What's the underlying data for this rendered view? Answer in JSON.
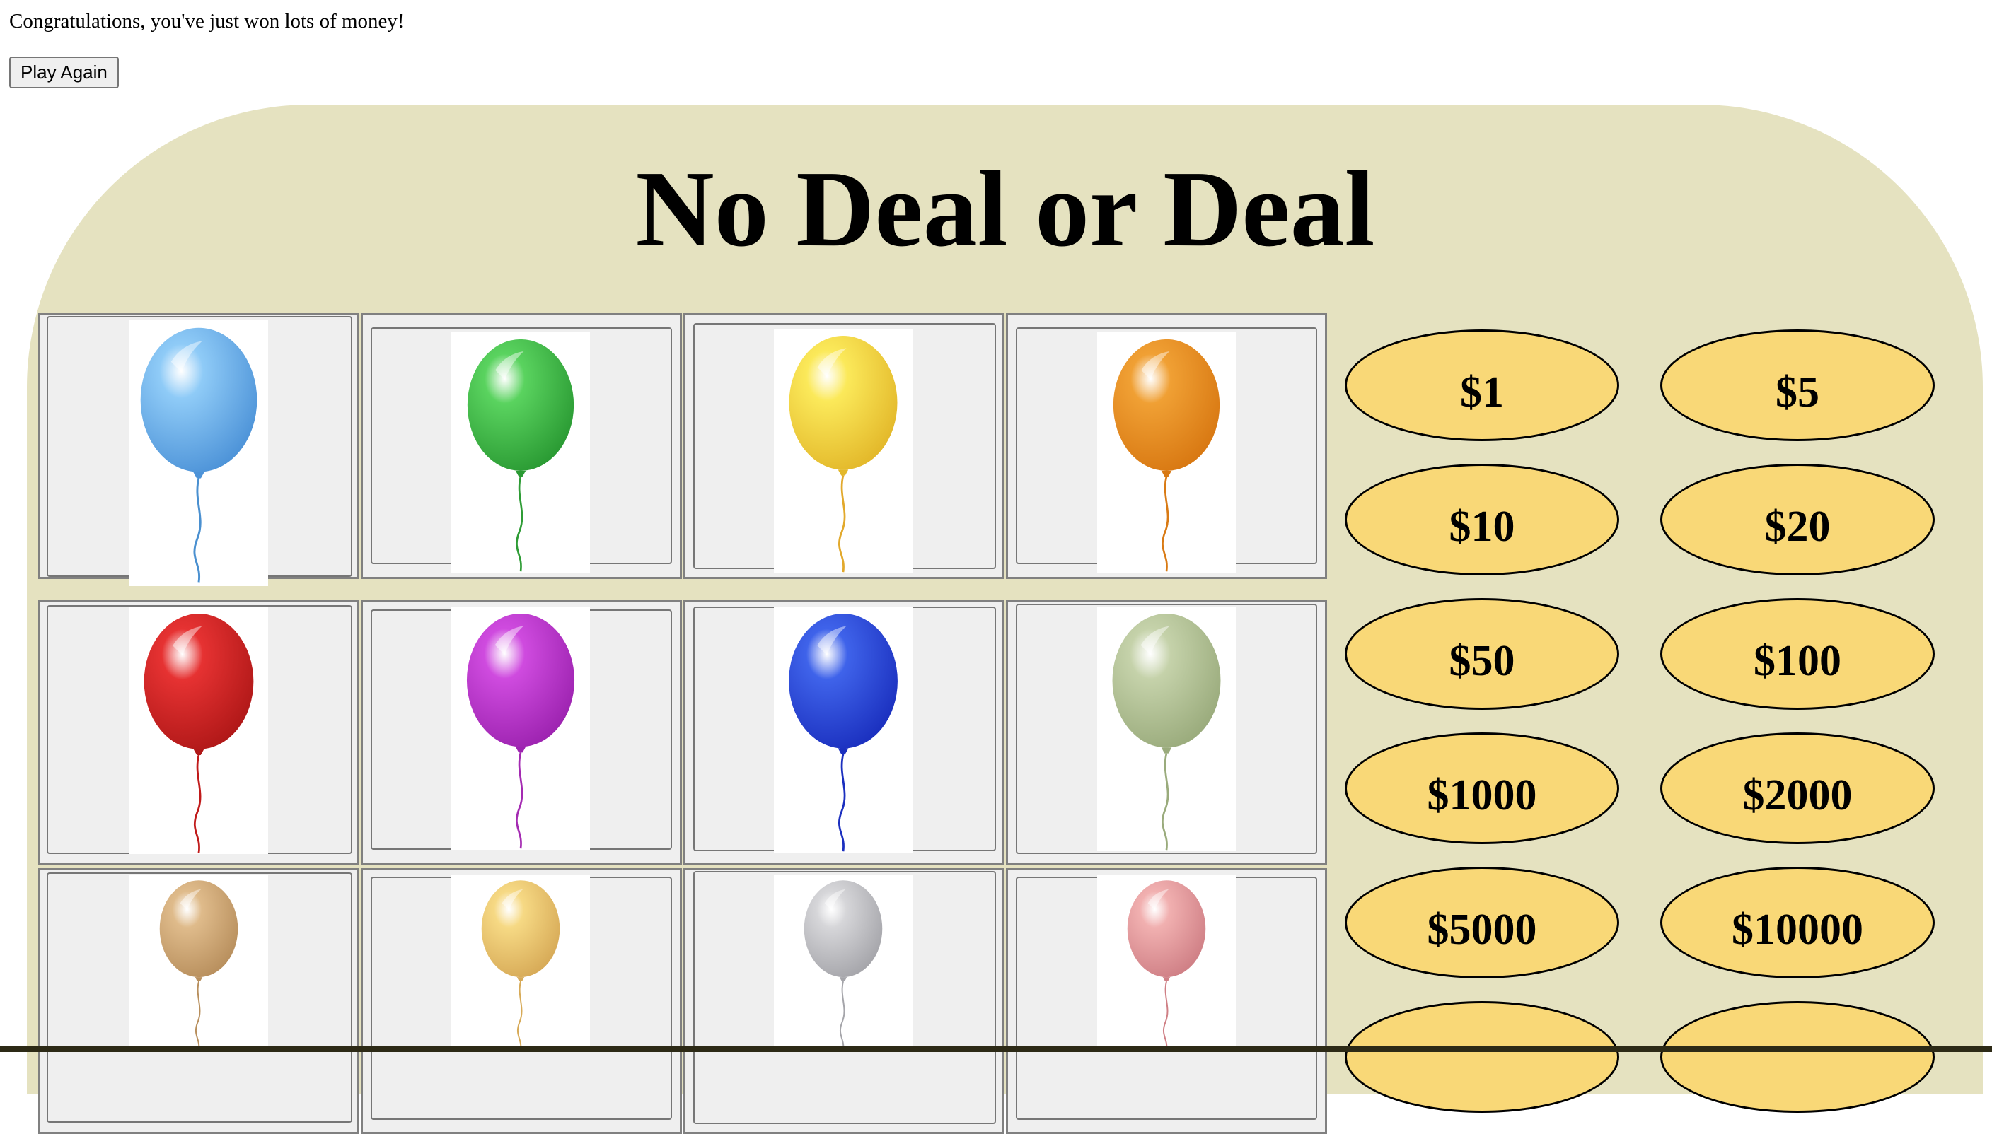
{
  "message": "Congratulations, you've just won lots of money!",
  "play_again_label": "Play Again",
  "title": "No Deal or Deal",
  "cases": [
    {
      "balloon_color": "light-blue",
      "fill": "#8fcbf7",
      "dark": "#4d93d8",
      "string": "#4a90d0"
    },
    {
      "balloon_color": "green",
      "fill": "#5ad35f",
      "dark": "#2a9a33",
      "string": "#2e9c35"
    },
    {
      "balloon_color": "yellow",
      "fill": "#fbe95a",
      "dark": "#e3b82a",
      "string": "#e2a92c"
    },
    {
      "balloon_color": "orange",
      "fill": "#f0a034",
      "dark": "#d87812",
      "string": "#d97a14"
    },
    {
      "balloon_color": "red",
      "fill": "#e63232",
      "dark": "#b01818",
      "string": "#c01a1a"
    },
    {
      "balloon_color": "purple",
      "fill": "#cf4bdf",
      "dark": "#9d23b0",
      "string": "#a42ab2"
    },
    {
      "balloon_color": "blue",
      "fill": "#3f63ea",
      "dark": "#1b30bf",
      "string": "#1b2fbf"
    },
    {
      "balloon_color": "sage",
      "fill": "#c5d2aa",
      "dark": "#9aab7c",
      "string": "#9aab7c"
    },
    {
      "balloon_color": "tan",
      "fill": "#dfbb8b",
      "dark": "#b88f5d",
      "string": "#b88f5d"
    },
    {
      "balloon_color": "pale-yellow",
      "fill": "#f6d984",
      "dark": "#d7aa57",
      "string": "#d7aa57"
    },
    {
      "balloon_color": "silver",
      "fill": "#d6d6d9",
      "dark": "#a5a5aa",
      "string": "#a5a5aa"
    },
    {
      "balloon_color": "pink",
      "fill": "#f1b0b0",
      "dark": "#cf7f85",
      "string": "#cf7f85"
    }
  ],
  "amounts": [
    "$1",
    "$5",
    "$10",
    "$20",
    "$50",
    "$100",
    "$1000",
    "$2000",
    "$5000",
    "$10000",
    "",
    ""
  ]
}
